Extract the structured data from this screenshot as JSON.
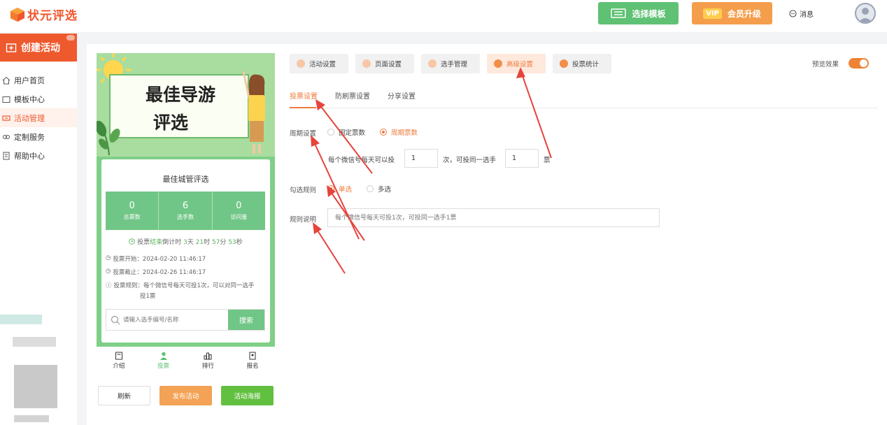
{
  "colors": {
    "brand": "#ee5a2d",
    "accent": "#ee7a3b",
    "green": "#70c686",
    "annotation_arrow": "#e6443c"
  },
  "header": {
    "logo_text": "状元评选",
    "select_template": "选择模板",
    "vip_badge": "VIP",
    "vip_upgrade": "会员升级",
    "messages": "消息"
  },
  "sidebar": {
    "create_label": "创建活动",
    "items": [
      {
        "label": "用户首页",
        "icon": "home-icon"
      },
      {
        "label": "模板中心",
        "icon": "folder-icon"
      },
      {
        "label": "活动管理",
        "icon": "ticket-icon",
        "active": true
      },
      {
        "label": "定制服务",
        "icon": "link-icon"
      },
      {
        "label": "帮助中心",
        "icon": "document-icon"
      }
    ]
  },
  "preview": {
    "banner_line1": "最佳导游",
    "banner_line2": "评选",
    "card_title": "最佳城管评选",
    "stats": [
      {
        "value": "0",
        "label": "总票数"
      },
      {
        "value": "6",
        "label": "选手数"
      },
      {
        "value": "0",
        "label": "访问量"
      }
    ],
    "countdown": {
      "prefix": "投票",
      "status": "结束",
      "label": "倒计时",
      "days": "3",
      "days_unit": "天",
      "hours": "21",
      "hours_unit": "时",
      "minutes": "57",
      "minutes_unit": "分",
      "seconds": "53",
      "seconds_unit": "秒"
    },
    "vote_start": "投票开始：2024-02-20 11:46:17",
    "vote_end": "投票截止：2024-02-26 11:46:17",
    "vote_rule_line1": "投票规则：每个微信号每天可投1次，可以对同一选手",
    "vote_rule_line2": "投1票",
    "search_placeholder": "请输入选手编号/名称",
    "search_button": "搜索",
    "tabs": [
      {
        "label": "介绍",
        "icon": "intro-icon"
      },
      {
        "label": "投票",
        "icon": "user-icon",
        "active": true
      },
      {
        "label": "排行",
        "icon": "rank-icon"
      },
      {
        "label": "报名",
        "icon": "signup-icon"
      }
    ]
  },
  "actions": {
    "refresh": "刷新",
    "publish": "发布活动",
    "poster": "活动海报"
  },
  "settings": {
    "top_tabs": [
      {
        "label": "活动设置"
      },
      {
        "label": "页面设置"
      },
      {
        "label": "选手管理"
      },
      {
        "label": "高级设置",
        "active": true
      },
      {
        "label": "投票统计"
      }
    ],
    "preview_effect": "预览效果",
    "preview_enabled": true,
    "sub_tabs": [
      {
        "label": "投票设置",
        "active": true
      },
      {
        "label": "防刷票设置"
      },
      {
        "label": "分享设置"
      }
    ],
    "cycle_label": "周期设置",
    "cycle_options": [
      {
        "label": "固定票数",
        "checked": false
      },
      {
        "label": "周期票数",
        "checked": true
      }
    ],
    "per_day_prefix": "每个微信号每天可以投",
    "per_day_value": "1",
    "per_day_mid": "次，可投同一选手",
    "same_player_value": "1",
    "per_day_suffix": "票",
    "select_rule_label": "勾选规则",
    "select_options": [
      {
        "label": "单选",
        "checked": true
      },
      {
        "label": "多选",
        "checked": false
      }
    ],
    "rule_desc_label": "规则说明",
    "rule_desc_placeholder": "每个微信号每天可投1次，可投同一选手1票"
  }
}
